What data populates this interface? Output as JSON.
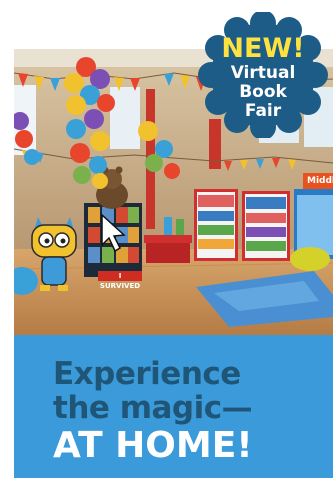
{
  "badge": {
    "headline": "NEW!",
    "lines": [
      "Virtual",
      "Book",
      "Fair"
    ],
    "fill_color": "#1c5c87",
    "headline_color": "#ffe23d"
  },
  "scene": {
    "sign_text": "Middle",
    "display_banner": "I SURVIVED",
    "icons": [
      "balloon-cluster-icon",
      "bookshelf-icon",
      "mascot-cat-icon",
      "cursor-arrow-icon",
      "bear-icon",
      "beanbag-icon",
      "rug-icon"
    ]
  },
  "tagline": {
    "line1": "Experience",
    "line2": "the magic—",
    "line3": "AT HOME!",
    "panel_color": "#3b9ad9",
    "text_color": "#1f5577"
  }
}
